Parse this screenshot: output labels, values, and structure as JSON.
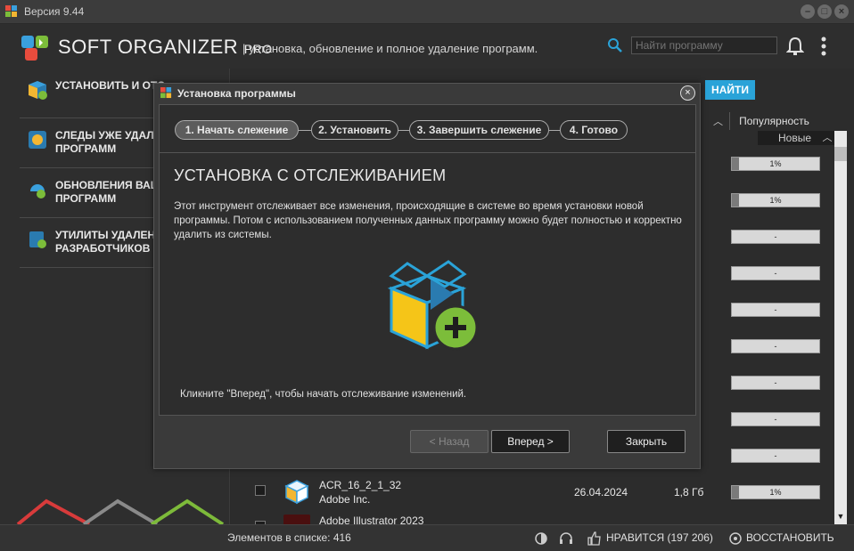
{
  "window": {
    "version": "Версия 9.44",
    "controls": [
      "minimize",
      "maximize",
      "close"
    ]
  },
  "header": {
    "brand": "SOFT ORGANIZER",
    "brand_suffix": "PRO",
    "tagline": "| установка, обновление и полное удаление программ.",
    "search_placeholder": "Найти программу"
  },
  "sidebar": {
    "items": [
      {
        "label": "УСТАНОВИТЬ И ОТС",
        "icon": "install-icon"
      },
      {
        "label": "СЛЕДЫ УЖЕ УДАЛЕ\nПРОГРАММ",
        "icon": "traces-icon"
      },
      {
        "label": "ОБНОВЛЕНИЯ ВАШ\nПРОГРАММ",
        "icon": "updates-icon"
      },
      {
        "label": "УТИЛИТЫ УДАЛЕН\nРАЗРАБОТЧИКОВ",
        "icon": "utilities-icon"
      }
    ],
    "accent_colors": [
      "#d83b3b",
      "#8a8a8a",
      "#7dba3a"
    ]
  },
  "list": {
    "find_button": "НАЙТИ",
    "popularity_header": "Популярность",
    "sort_label": "Новые",
    "popularity_values": [
      "1%",
      "1%",
      "-",
      "-",
      "-",
      "-",
      "-",
      "-",
      "-",
      "1%",
      "-"
    ],
    "rows": [
      {
        "name": "ACR_16_2_1_32",
        "publisher": "Adobe Inc.",
        "date": "26.04.2024",
        "size": "1,8 Гб"
      },
      {
        "name": "Adobe Illustrator 2023",
        "publisher": "",
        "date": "",
        "size": ""
      }
    ]
  },
  "status": {
    "count": "Элементов в списке: 416",
    "likes": "НРАВИТСЯ (197 206)",
    "restore": "ВОССТАНОВИТЬ"
  },
  "dialog": {
    "title": "Установка программы",
    "steps": [
      "1. Начать слежение",
      "2. Установить",
      "3. Завершить слежение",
      "4. Готово"
    ],
    "active_step": 0,
    "heading": "УСТАНОВКА С ОТСЛЕЖИВАНИЕМ",
    "description": "Этот инструмент отслеживает все изменения, происходящие в системе во время установки новой программы. Потом с использованием полученных данных программу можно будет полностью и корректно удалить из системы.",
    "hint": "Кликните \"Вперед\", чтобы начать отслеживание изменений.",
    "buttons": {
      "back": "< Назад",
      "next": "Вперед >",
      "close": "Закрыть"
    }
  }
}
